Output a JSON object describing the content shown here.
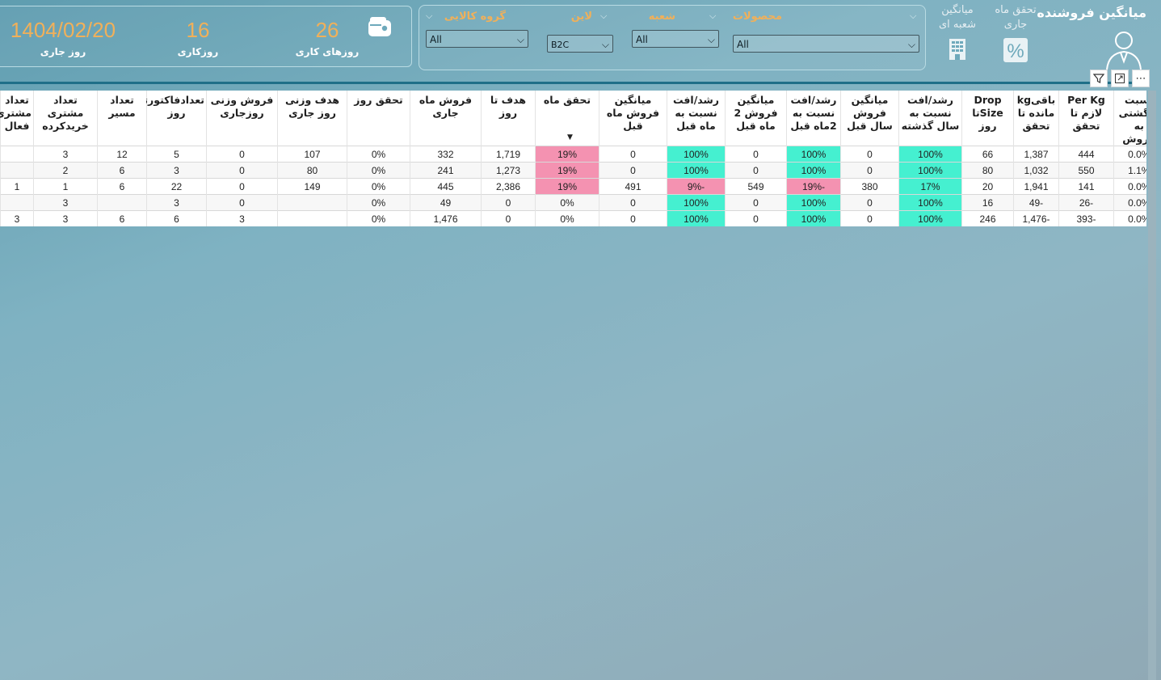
{
  "kpis": {
    "current_day_value": "1404/02/20",
    "current_day_label": "روز جاری",
    "workday_value": "16",
    "workday_label": "روزکاری",
    "working_days_value": "26",
    "working_days_label": "روزهای کاری",
    "wallet_icon": "wallet-icon"
  },
  "filters": {
    "product_group": {
      "title": "گروه کالایی",
      "value": "All"
    },
    "line": {
      "title": "لاین",
      "value": "B2C"
    },
    "branch": {
      "title": "شعبه",
      "value": "All"
    },
    "products": {
      "title": "محصولات",
      "value": "All"
    }
  },
  "nav": {
    "title": "میانگین فروشنده",
    "monthly_achievement": "تحقق ماه جاری",
    "branch_average": "میانگین شعبه ای",
    "percent_icon": "percent-icon",
    "building_icon": "building-icon",
    "person_icon": "person-icon"
  },
  "visual_header": {
    "more": "⋯",
    "focus": "⤢",
    "filter": "⏷"
  },
  "table": {
    "columns": [
      "نسبت برگشتی به فروش",
      "Per Kg لازم تا تحقق",
      "باقیkg مانده تا تحقق",
      "Drop Sizeتا روز",
      "رشد/افت نسبت به سال گذشته",
      "میانگین فروش سال قبل",
      "رشد/افت نسبت به 2ماه قبل",
      "میانگین فروش 2 ماه قبل",
      "رشد/افت نسبت به ماه قبل",
      "میانگین فروش ماه قبل",
      "تحقق ماه",
      "هدف تا روز",
      "فروش ماه جاری",
      "تحقق روز",
      "هدف وزنی روز جاری",
      "فروش وزنی روزجاری",
      "تعدادفاکتورتا روز",
      "تعداد مسیر",
      "تعداد مشتری خریدکرده",
      "تعداد مشتری فعال"
    ],
    "rows": [
      [
        "0.0%",
        "444",
        "1,387",
        "66",
        "100%",
        "0",
        "100%",
        "0",
        "100%",
        "0",
        "19%",
        "1,719",
        "332",
        "0%",
        "107",
        "0",
        "5",
        "12",
        "3",
        ""
      ],
      [
        "1.1%",
        "550",
        "1,032",
        "80",
        "100%",
        "0",
        "100%",
        "0",
        "100%",
        "0",
        "19%",
        "1,273",
        "241",
        "0%",
        "80",
        "0",
        "3",
        "6",
        "2",
        ""
      ],
      [
        "0.0%",
        "141",
        "1,941",
        "20",
        "17%",
        "380",
        "-19%",
        "549",
        "-9%",
        "491",
        "19%",
        "2,386",
        "445",
        "0%",
        "149",
        "0",
        "22",
        "6",
        "1",
        "1"
      ],
      [
        "0.0%",
        "-26",
        "-49",
        "16",
        "100%",
        "0",
        "100%",
        "0",
        "100%",
        "0",
        "0%",
        "0",
        "49",
        "0%",
        "",
        "0",
        "3",
        "",
        "3",
        ""
      ],
      [
        "0.0%",
        "-393",
        "-1,476",
        "246",
        "100%",
        "0",
        "100%",
        "0",
        "100%",
        "0",
        "0%",
        "0",
        "1,476",
        "0%",
        "",
        "3",
        "6",
        "6",
        "3",
        "3"
      ]
    ]
  }
}
